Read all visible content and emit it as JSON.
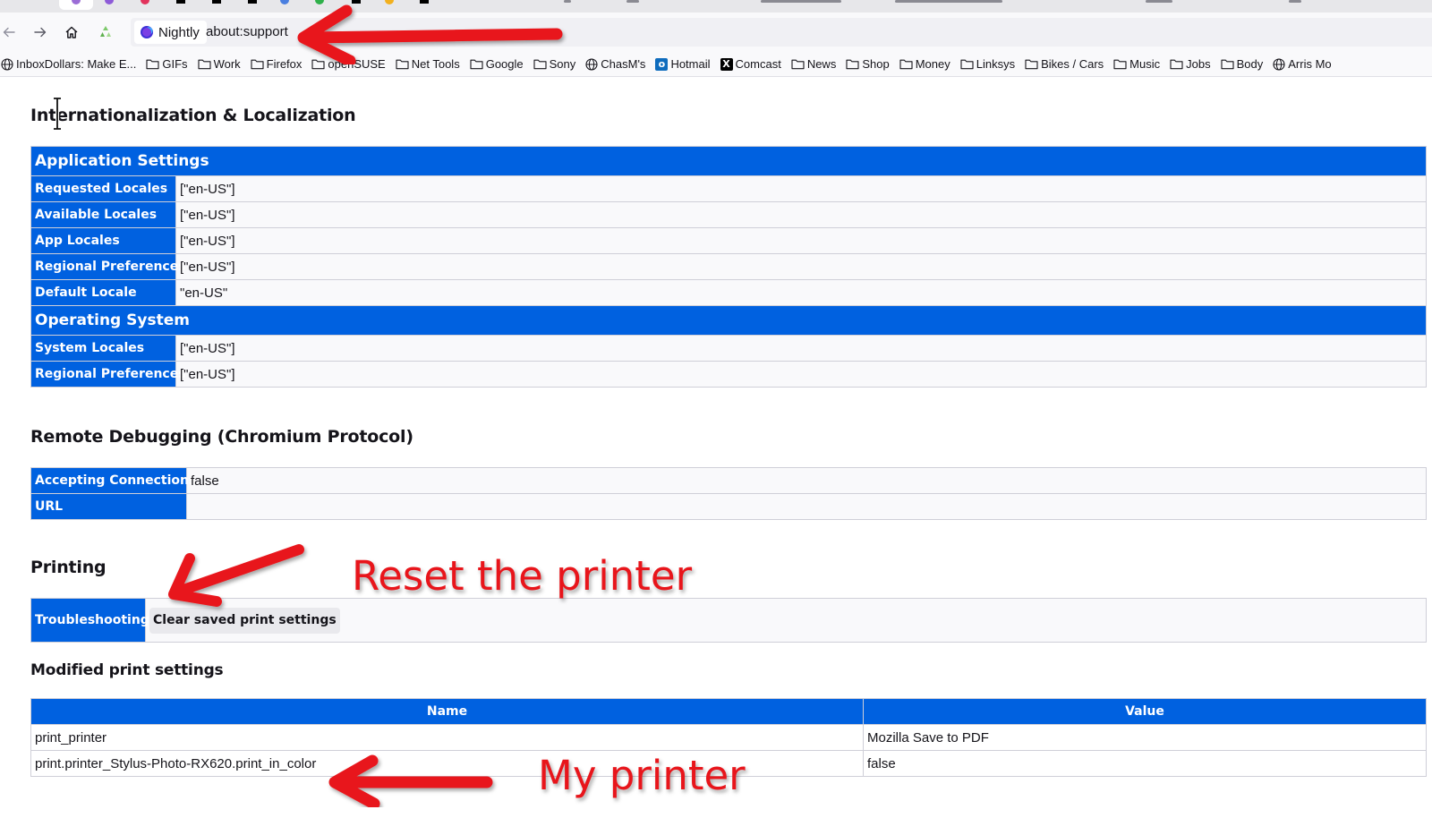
{
  "browser": {
    "identity_label": "Nightly",
    "url": "about:support"
  },
  "bookmarks": [
    {
      "label": "InboxDollars: Make E...",
      "icon": "globe-icon"
    },
    {
      "label": "GIFs",
      "icon": "folder-icon"
    },
    {
      "label": "Work",
      "icon": "folder-icon"
    },
    {
      "label": "Firefox",
      "icon": "folder-icon"
    },
    {
      "label": "openSUSE",
      "icon": "folder-icon"
    },
    {
      "label": "Net Tools",
      "icon": "folder-icon"
    },
    {
      "label": "Google",
      "icon": "folder-icon"
    },
    {
      "label": "Sony",
      "icon": "folder-icon"
    },
    {
      "label": "ChasM's",
      "icon": "globe-icon"
    },
    {
      "label": "Hotmail",
      "icon": "outlook-icon"
    },
    {
      "label": "Comcast",
      "icon": "x-icon"
    },
    {
      "label": "News",
      "icon": "folder-icon"
    },
    {
      "label": "Shop",
      "icon": "folder-icon"
    },
    {
      "label": "Money",
      "icon": "folder-icon"
    },
    {
      "label": "Linksys",
      "icon": "folder-icon"
    },
    {
      "label": "Bikes / Cars",
      "icon": "folder-icon"
    },
    {
      "label": "Music",
      "icon": "folder-icon"
    },
    {
      "label": "Jobs",
      "icon": "folder-icon"
    },
    {
      "label": "Body",
      "icon": "folder-icon"
    },
    {
      "label": "Arris Mo",
      "icon": "globe-icon"
    }
  ],
  "intl": {
    "title": "Internationalization & Localization",
    "app_group": "Application Settings",
    "app_rows": [
      {
        "key": "Requested Locales",
        "value": "[\"en-US\"]"
      },
      {
        "key": "Available Locales",
        "value": "[\"en-US\"]"
      },
      {
        "key": "App Locales",
        "value": "[\"en-US\"]"
      },
      {
        "key": "Regional Preferences",
        "value": "[\"en-US\"]"
      },
      {
        "key": "Default Locale",
        "value": "\"en-US\""
      }
    ],
    "os_group": "Operating System",
    "os_rows": [
      {
        "key": "System Locales",
        "value": "[\"en-US\"]"
      },
      {
        "key": "Regional Preferences",
        "value": "[\"en-US\"]"
      }
    ]
  },
  "remote": {
    "title": "Remote Debugging (Chromium Protocol)",
    "rows": [
      {
        "key": "Accepting Connections",
        "value": "false"
      },
      {
        "key": "URL",
        "value": ""
      }
    ]
  },
  "printing": {
    "title": "Printing",
    "troubleshooting_label": "Troubleshooting",
    "clear_button": "Clear saved print settings",
    "modified_title": "Modified print settings",
    "col_name": "Name",
    "col_value": "Value",
    "rows": [
      {
        "name": "print_printer",
        "value": "Mozilla Save to PDF"
      },
      {
        "name": "print.printer_Stylus-Photo-RX620.print_in_color",
        "value": "false"
      }
    ]
  },
  "annotations": {
    "reset": "Reset the printer",
    "my_printer": "My printer",
    "color": "#e8151b"
  },
  "colors": {
    "accent": "#0061e0"
  }
}
